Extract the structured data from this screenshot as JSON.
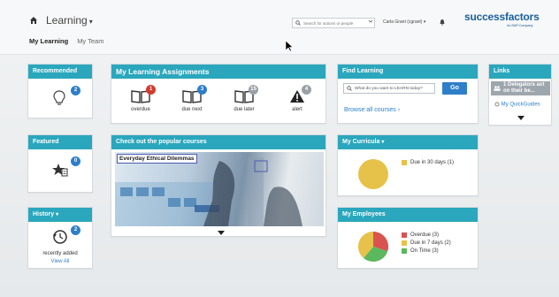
{
  "header": {
    "module": "Learning",
    "module_caret": "▾",
    "search_placeholder": "Search for actions or people",
    "user": "Carla Grant (cgrant) ▾",
    "logo": "successfactors",
    "logo_sub": "An SAP Company",
    "tabs": [
      {
        "label": "My Learning"
      },
      {
        "label": "My Team"
      }
    ]
  },
  "recommended": {
    "title": "Recommended",
    "badge": "2"
  },
  "assignments": {
    "title": "My Learning Assignments",
    "items": [
      {
        "label": "overdue",
        "badge": "1",
        "color": "#d43a2f"
      },
      {
        "label": "due next",
        "badge": "3",
        "color": "#2d7fc9"
      },
      {
        "label": "due later",
        "badge": "15",
        "color": "#9aa0a6"
      },
      {
        "label": "alert",
        "badge": "4",
        "color": "#9aa0a6"
      }
    ]
  },
  "find_learning": {
    "title": "Find Learning",
    "placeholder": "What do you want to LEARN today?",
    "go": "Go",
    "browse": "Browse all courses"
  },
  "links": {
    "title": "Links",
    "delegators": "1 Delegators act on their be...",
    "quickguides": "My QuickGuides"
  },
  "featured": {
    "title": "Featured",
    "badge": "0"
  },
  "popular": {
    "title": "Check out the popular courses",
    "course": "Everyday Ethical Dilemmas"
  },
  "curricula": {
    "title": "My Curricula",
    "legend": [
      {
        "label": "Due in 30 days (1)",
        "color": "#e6c24a"
      }
    ]
  },
  "history": {
    "title": "History",
    "badge": "2",
    "recent": "recently added",
    "view_all": "View All"
  },
  "employees": {
    "title": "My Employees",
    "legend": [
      {
        "label": "Overdue (3)",
        "color": "#d9534f"
      },
      {
        "label": "Due in 7 days (2)",
        "color": "#e6c24a"
      },
      {
        "label": "On Time (3)",
        "color": "#5cb85c"
      }
    ]
  },
  "colors": {
    "tile_header": "#2aa7bd",
    "link": "#2d7fc9",
    "logo": "#1a5f9e"
  }
}
